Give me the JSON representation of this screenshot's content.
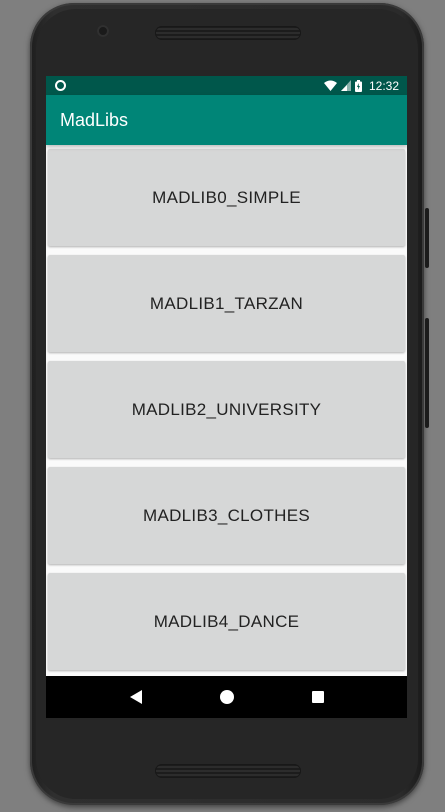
{
  "status_bar": {
    "time": "12:32",
    "icons": [
      "notification-dot-icon",
      "wifi-icon",
      "signal-icon",
      "battery-icon"
    ]
  },
  "app_bar": {
    "title": "MadLibs",
    "color": "#008577",
    "status_color": "#00574b"
  },
  "buttons": [
    {
      "label": "MADLIB0_SIMPLE"
    },
    {
      "label": "MADLIB1_TARZAN"
    },
    {
      "label": "MADLIB2_UNIVERSITY"
    },
    {
      "label": "MADLIB3_CLOTHES"
    },
    {
      "label": "MADLIB4_DANCE"
    }
  ],
  "nav_bar": {
    "items": [
      "back-icon",
      "home-icon",
      "recents-icon"
    ]
  }
}
